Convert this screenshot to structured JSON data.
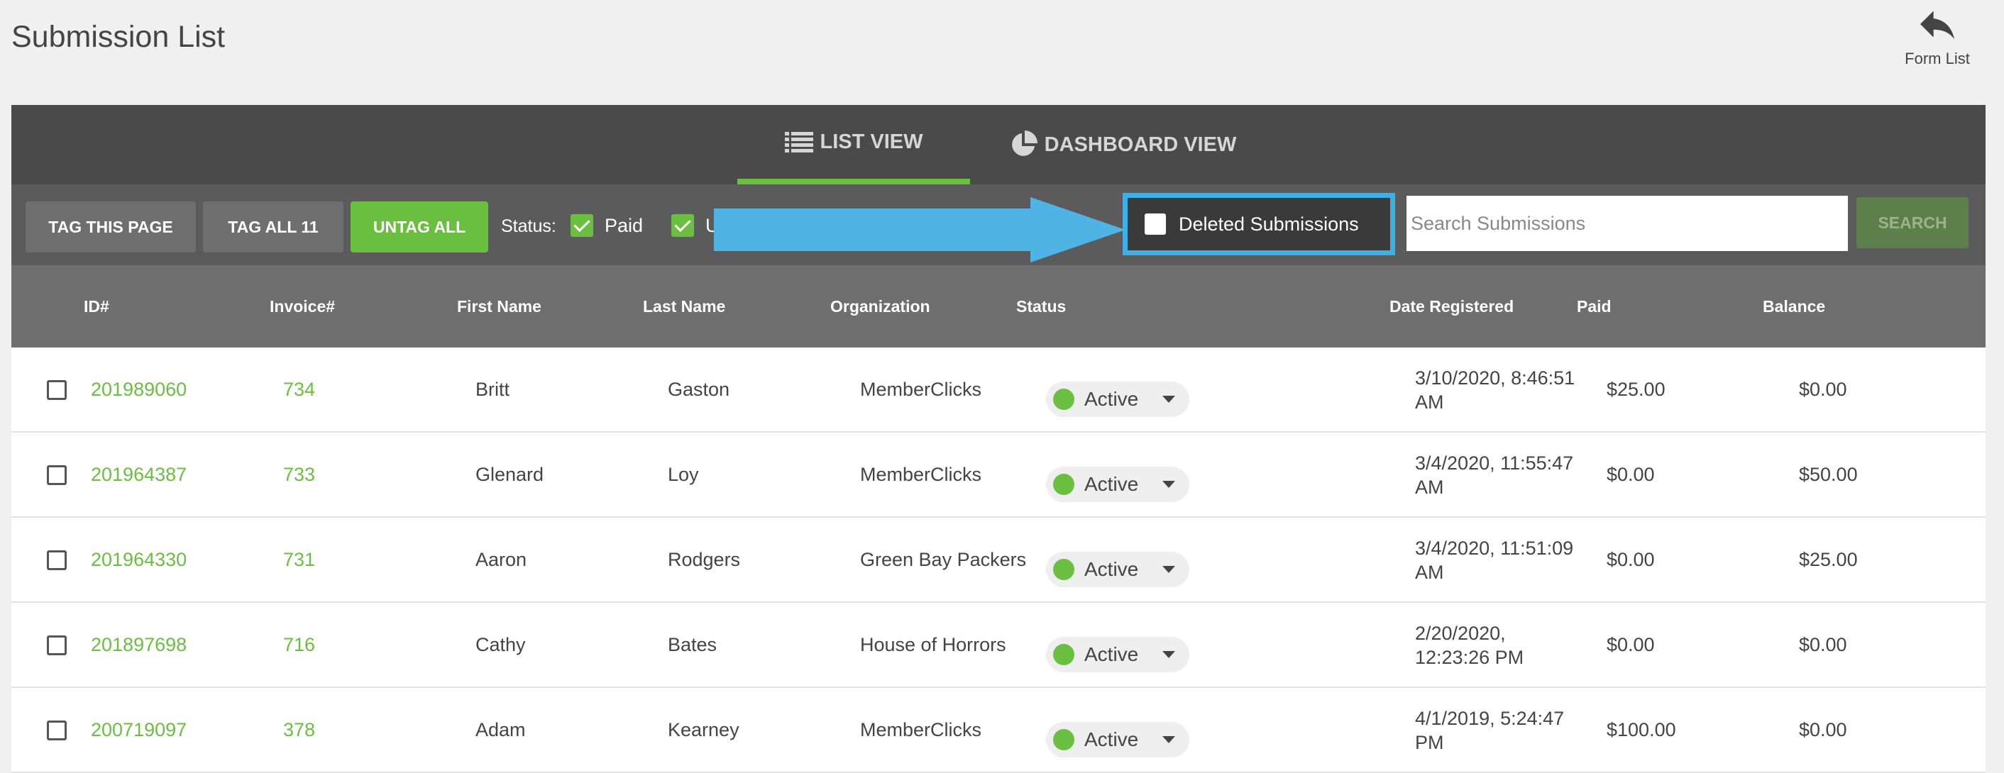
{
  "header": {
    "title": "Submission List",
    "form_list_label": "Form List"
  },
  "tabs": [
    {
      "label": "LIST VIEW",
      "icon": "list-icon",
      "active": true
    },
    {
      "label": "DASHBOARD VIEW",
      "icon": "pie-chart-icon",
      "active": false
    }
  ],
  "toolbar": {
    "tag_page": "TAG THIS PAGE",
    "tag_all": "TAG ALL 11",
    "untag_all": "UNTAG ALL",
    "status_label": "Status:",
    "paid_label": "Paid",
    "unpaid_partial": "U",
    "deleted_label": "Deleted Submissions",
    "search_placeholder": "Search Submissions",
    "search_button": "SEARCH"
  },
  "table": {
    "headers": [
      "ID#",
      "Invoice#",
      "First Name",
      "Last Name",
      "Organization",
      "Status",
      "Date Registered",
      "Paid",
      "Balance"
    ],
    "rows": [
      {
        "id": "201989060",
        "invoice": "734",
        "first": "Britt",
        "last": "Gaston",
        "org": "MemberClicks",
        "status": "Active",
        "date1": "3/10/2020, 8:46:51",
        "date2": "AM",
        "paid": "$25.00",
        "balance": "$0.00"
      },
      {
        "id": "201964387",
        "invoice": "733",
        "first": "Glenard",
        "last": "Loy",
        "org": "MemberClicks",
        "status": "Active",
        "date1": "3/4/2020, 11:55:47",
        "date2": "AM",
        "paid": "$0.00",
        "balance": "$50.00"
      },
      {
        "id": "201964330",
        "invoice": "731",
        "first": "Aaron",
        "last": "Rodgers",
        "org": "Green Bay Packers",
        "status": "Active",
        "date1": "3/4/2020, 11:51:09",
        "date2": "AM",
        "paid": "$0.00",
        "balance": "$25.00"
      },
      {
        "id": "201897698",
        "invoice": "716",
        "first": "Cathy",
        "last": "Bates",
        "org": "House of Horrors",
        "status": "Active",
        "date1": "2/20/2020,",
        "date2": "12:23:26 PM",
        "paid": "$0.00",
        "balance": "$0.00"
      },
      {
        "id": "200719097",
        "invoice": "378",
        "first": "Adam",
        "last": "Kearney",
        "org": "MemberClicks",
        "status": "Active",
        "date1": "4/1/2019, 5:24:47",
        "date2": "PM",
        "paid": "$100.00",
        "balance": "$0.00"
      }
    ]
  },
  "colors": {
    "accent": "#6abf40",
    "highlight": "#3fb0e6",
    "dark": "#4a4a4a"
  }
}
